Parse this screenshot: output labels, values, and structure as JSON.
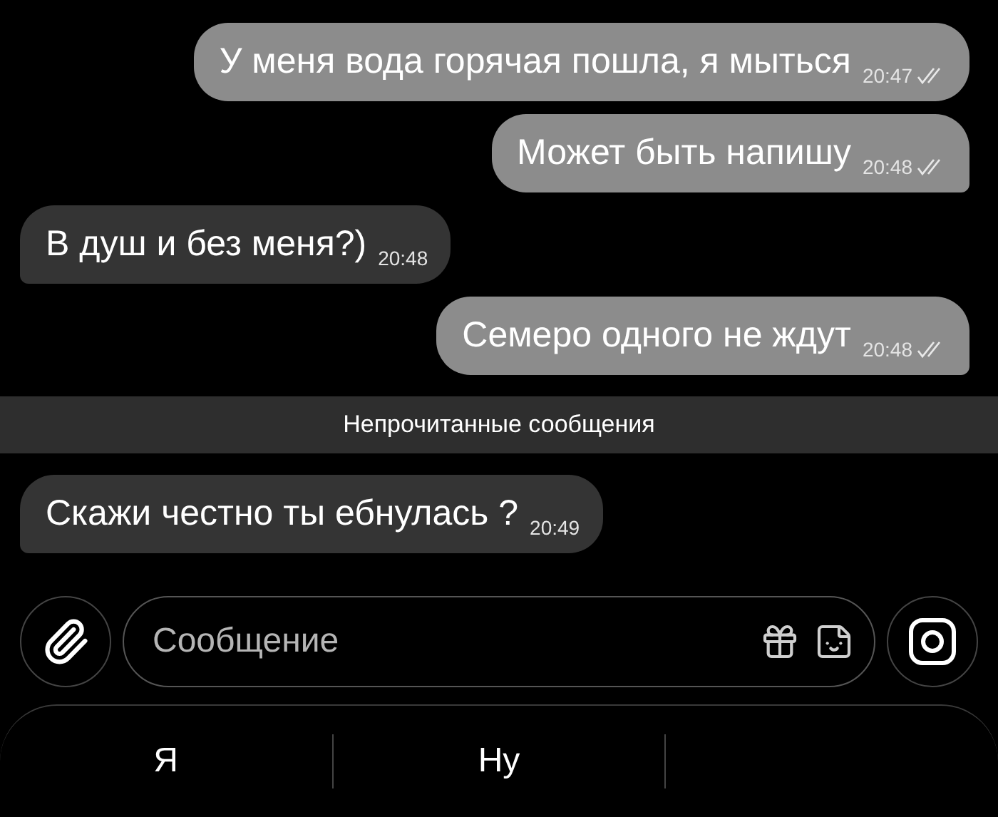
{
  "messages": [
    {
      "kind": "outgoing",
      "text": "У меня вода горячая пошла, я мыться",
      "time": "20:47",
      "tail": false
    },
    {
      "kind": "outgoing",
      "text": "Может быть напишу",
      "time": "20:48",
      "tail": true
    },
    {
      "kind": "incoming",
      "text": "В душ и без меня?)",
      "time": "20:48",
      "tail": true
    },
    {
      "kind": "outgoing",
      "text": "Семеро одного не ждут",
      "time": "20:48",
      "tail": true
    },
    {
      "kind": "divider",
      "text": "Непрочитанные сообщения"
    },
    {
      "kind": "incoming",
      "text": "Скажи честно ты ебнулась ?",
      "time": "20:49",
      "tail": true
    }
  ],
  "composer": {
    "placeholder": "Сообщение"
  },
  "suggestions": [
    "Я",
    "Ну"
  ]
}
